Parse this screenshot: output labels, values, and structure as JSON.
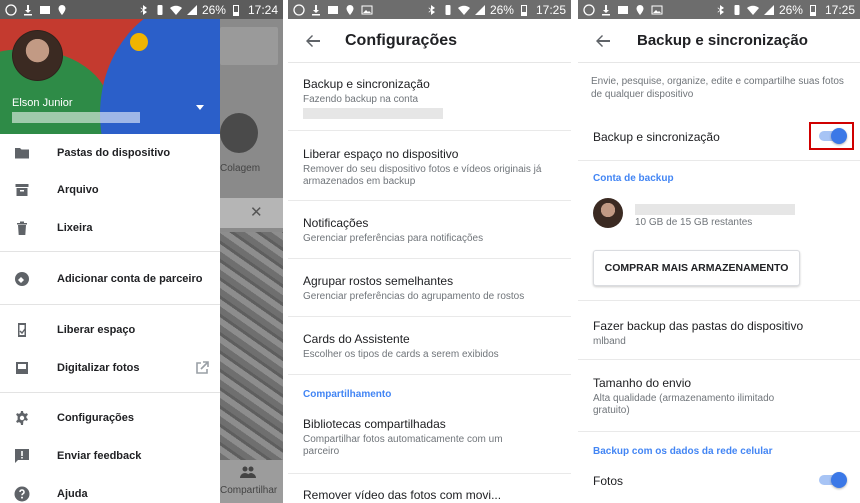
{
  "status_bars": [
    {
      "battery": "26%",
      "time": "17:24"
    },
    {
      "battery": "26%",
      "time": "17:25"
    },
    {
      "battery": "26%",
      "time": "17:25"
    }
  ],
  "panel1": {
    "background": {
      "collage_label": "Colagem",
      "share_label": "Compartilhar",
      "close_glyph": "✕"
    },
    "drawer": {
      "user_name": "Elson Junior",
      "items": [
        {
          "label": "Pastas do dispositivo",
          "icon": "folder-icon"
        },
        {
          "label": "Arquivo",
          "icon": "archive-icon"
        },
        {
          "label": "Lixeira",
          "icon": "trash-icon"
        },
        {
          "label": "Adicionar conta de parceiro",
          "icon": "partner-sharing-icon"
        },
        {
          "label": "Liberar espaço",
          "icon": "free-up-space-icon"
        },
        {
          "label": "Digitalizar fotos",
          "icon": "photo-scan-icon"
        },
        {
          "label": "Configurações",
          "icon": "gear-icon"
        },
        {
          "label": "Enviar feedback",
          "icon": "feedback-icon"
        },
        {
          "label": "Ajuda",
          "icon": "help-icon"
        }
      ]
    }
  },
  "panel2": {
    "title": "Configurações",
    "items": [
      {
        "title": "Backup e sincronização",
        "subtitle": "Fazendo backup na conta"
      },
      {
        "title": "Liberar espaço no dispositivo",
        "subtitle": "Remover do seu dispositivo fotos e vídeos originais já armazenados em backup"
      },
      {
        "title": "Notificações",
        "subtitle": "Gerenciar preferências para notificações"
      },
      {
        "title": "Agrupar rostos semelhantes",
        "subtitle": "Gerenciar preferências do agrupamento de rostos"
      },
      {
        "title": "Cards do Assistente",
        "subtitle": "Escolher os tipos de cards a serem exibidos"
      },
      {
        "title": "Bibliotecas compartilhadas",
        "subtitle": "Compartilhar fotos automaticamente com um parceiro"
      },
      {
        "title": "Remover vídeo das fotos com movi..."
      }
    ],
    "section_sharing": "Compartilhamento"
  },
  "panel3": {
    "title": "Backup e sincronização",
    "intro": "Envie, pesquise, organize, edite e compartilhe suas fotos de qualquer dispositivo",
    "backup_toggle": {
      "label": "Backup e sincronização",
      "on": true
    },
    "section_account": "Conta de backup",
    "storage": "10 GB de 15 GB restantes",
    "buy_button": "COMPRAR MAIS ARMAZENAMENTO",
    "device_folders": {
      "title": "Fazer backup das pastas do dispositivo",
      "subtitle": "mlband"
    },
    "upload_size": {
      "title": "Tamanho do envio",
      "subtitle": "Alta qualidade (armazenamento ilimitado gratuito)"
    },
    "section_cellular": "Backup com os dados da rede celular",
    "photos_toggle": {
      "label": "Fotos",
      "on": true
    }
  },
  "colors": {
    "accent": "#4285f4",
    "toggle_on": "#3b78e7",
    "highlight": "#d00000"
  }
}
